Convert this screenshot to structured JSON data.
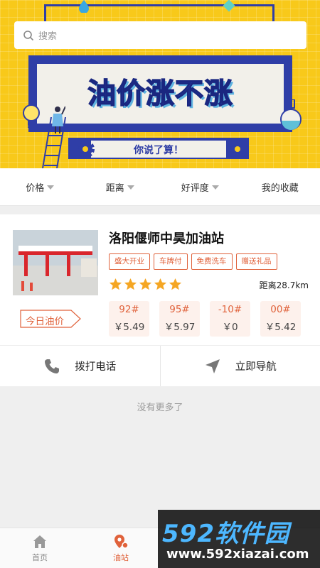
{
  "search": {
    "placeholder": "搜索",
    "icon": "search-icon"
  },
  "banner": {
    "title": "油价涨不涨",
    "subtitle": "你说了算！"
  },
  "filters": [
    {
      "label": "价格",
      "has_dropdown": true
    },
    {
      "label": "距离",
      "has_dropdown": true
    },
    {
      "label": "好评度",
      "has_dropdown": true
    },
    {
      "label": "我的收藏",
      "has_dropdown": false
    }
  ],
  "station": {
    "name": "洛阳偃师中昊加油站",
    "tags": [
      "盛大开业",
      "车牌付",
      "免费洗车",
      "赠送礼品"
    ],
    "rating": 5,
    "rating_max": 5,
    "distance": "距离28.7km",
    "today_label": "今日油价",
    "prices": [
      {
        "grade": "92#",
        "price": "￥5.49"
      },
      {
        "grade": "95#",
        "price": "￥5.97"
      },
      {
        "grade": "-10#",
        "price": "￥0"
      },
      {
        "grade": "00#",
        "price": "￥5.42"
      }
    ],
    "actions": {
      "call": "拨打电话",
      "navigate": "立即导航"
    }
  },
  "no_more": "没有更多了",
  "tabbar": {
    "home": "首页",
    "stations": "油站"
  },
  "watermark": {
    "brand": "592软件园",
    "url": "www.592xiazai.com"
  },
  "colors": {
    "accent": "#e0623b",
    "banner_yellow": "#f8c91a",
    "banner_blue": "#2f3ea7",
    "star": "#f5a623"
  }
}
